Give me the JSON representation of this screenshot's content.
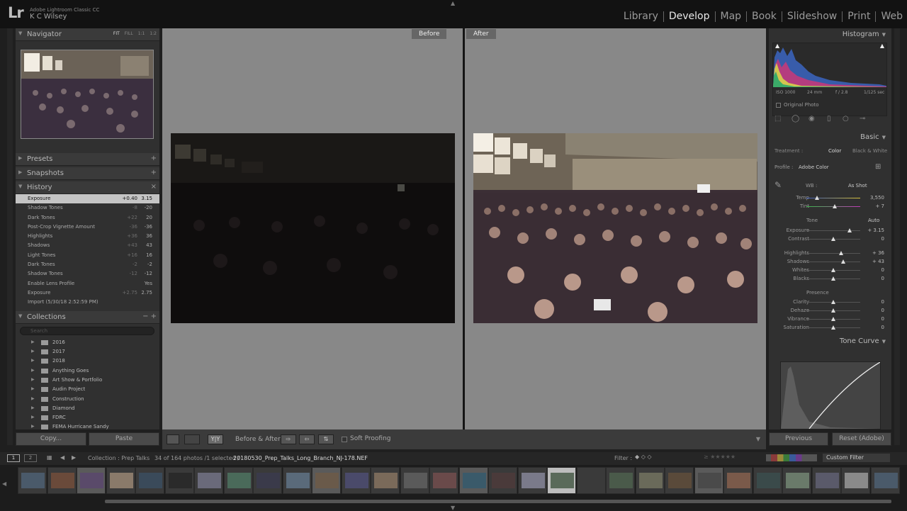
{
  "app": {
    "name": "Adobe Lightroom Classic CC",
    "logo": "Lr",
    "user": "K C Wilsey"
  },
  "modules": [
    {
      "label": "Library",
      "active": false
    },
    {
      "label": "Develop",
      "active": true
    },
    {
      "label": "Map",
      "active": false
    },
    {
      "label": "Book",
      "active": false
    },
    {
      "label": "Slideshow",
      "active": false
    },
    {
      "label": "Print",
      "active": false
    },
    {
      "label": "Web",
      "active": false
    }
  ],
  "left": {
    "navigator": {
      "title": "Navigator",
      "zoom": [
        "FIT",
        "FILL",
        "1:1",
        "1:2"
      ]
    },
    "presets": "Presets",
    "snapshots": "Snapshots",
    "history": {
      "title": "History",
      "items": [
        {
          "name": "Exposure",
          "delta": "+0.40",
          "value": "3.15"
        },
        {
          "name": "Shadow Tones",
          "delta": "-8",
          "value": "-20"
        },
        {
          "name": "Dark Tones",
          "delta": "+22",
          "value": "20"
        },
        {
          "name": "Post-Crop Vignette Amount",
          "delta": "-36",
          "value": "-36"
        },
        {
          "name": "Highlights",
          "delta": "+36",
          "value": "36"
        },
        {
          "name": "Shadows",
          "delta": "+43",
          "value": "43"
        },
        {
          "name": "Light Tones",
          "delta": "+16",
          "value": "16"
        },
        {
          "name": "Dark Tones",
          "delta": "-2",
          "value": "-2"
        },
        {
          "name": "Shadow Tones",
          "delta": "-12",
          "value": "-12"
        },
        {
          "name": "Enable Lens Profile",
          "delta": "",
          "value": "Yes"
        },
        {
          "name": "Exposure",
          "delta": "+2.75",
          "value": "2.75"
        },
        {
          "name": "Import (5/30/18 2:52:59 PM)",
          "delta": "",
          "value": ""
        }
      ]
    },
    "collections": {
      "title": "Collections",
      "search_placeholder": "Search",
      "items": [
        "2016",
        "2017",
        "2018",
        "Anything Goes",
        "Art Show & Portfolio",
        "Audin Project",
        "Construction",
        "Diamond",
        "FDRC",
        "FEMA Hurricane Sandy"
      ]
    },
    "copy_btn": "Copy...",
    "paste_btn": "Paste"
  },
  "center": {
    "before_label": "Before",
    "after_label": "After"
  },
  "toolbar": {
    "before_after": "Before & After :",
    "view_mode": "Y|Y",
    "soft_proofing": "Soft Proofing"
  },
  "right": {
    "histogram": {
      "title": "Histogram",
      "iso": "ISO 1000",
      "focal": "24 mm",
      "aperture": "f / 2.8",
      "shutter": "1/125 sec",
      "original": "Original Photo"
    },
    "basic": {
      "title": "Basic",
      "treatment_label": "Treatment :",
      "treatment_color": "Color",
      "treatment_bw": "Black & White",
      "profile_label": "Profile :",
      "profile_value": "Adobe Color",
      "wb_label": "WB :",
      "wb_value": "As Shot",
      "temp": {
        "label": "Temp",
        "value": "3,550",
        "pos": 0.2
      },
      "tint": {
        "label": "Tint",
        "value": "+ 7",
        "pos": 0.52
      },
      "tone_label": "Tone",
      "auto_label": "Auto",
      "tone": [
        {
          "label": "Exposure",
          "value": "+ 3.15",
          "pos": 0.8
        },
        {
          "label": "Contrast",
          "value": "0",
          "pos": 0.5
        }
      ],
      "tone2": [
        {
          "label": "Highlights",
          "value": "+ 36",
          "pos": 0.65
        },
        {
          "label": "Shadows",
          "value": "+ 43",
          "pos": 0.68
        },
        {
          "label": "Whites",
          "value": "0",
          "pos": 0.5
        },
        {
          "label": "Blacks",
          "value": "0",
          "pos": 0.5
        }
      ],
      "presence_label": "Presence",
      "presence": [
        {
          "label": "Clarity",
          "value": "0",
          "pos": 0.5
        },
        {
          "label": "Dehaze",
          "value": "0",
          "pos": 0.5
        },
        {
          "label": "Vibrance",
          "value": "0",
          "pos": 0.5
        },
        {
          "label": "Saturation",
          "value": "0",
          "pos": 0.5
        }
      ]
    },
    "tone_curve": "Tone Curve",
    "previous_btn": "Previous",
    "reset_btn": "Reset (Adobe)"
  },
  "filmstrip": {
    "page1": "1",
    "page2": "2",
    "collection": "Collection : Prep Talks",
    "count": "34 of 164 photos /1 selected /",
    "filename": "20180530_Prep_Talks_Long_Branch_NJ-178.NEF",
    "filter_label": "Filter :",
    "custom_filter": "Custom Filter"
  },
  "colors": {
    "accent": "#c4c4c4",
    "panel": "#303030",
    "bg": "#1f1f1f"
  }
}
